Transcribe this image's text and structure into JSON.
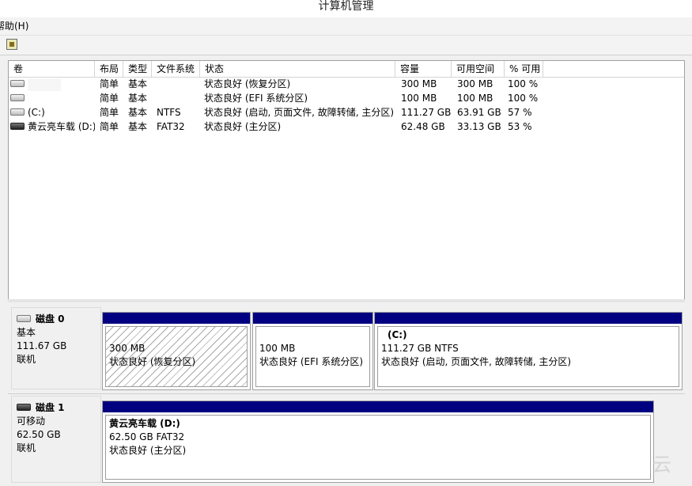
{
  "window": {
    "title": "计算机管理"
  },
  "menu": {
    "help": "帮助(H)"
  },
  "toolbar": {
    "icon": "disk-properties-icon"
  },
  "volumes": {
    "columns": [
      "卷",
      "布局",
      "类型",
      "文件系统",
      "状态",
      "容量",
      "可用空间",
      "% 可用"
    ],
    "rows": [
      {
        "icon": "drive-icon",
        "volume": "",
        "layout": "简单",
        "type": "基本",
        "fs": "",
        "status": "状态良好 (恢复分区)",
        "capacity": "300 MB",
        "free": "300 MB",
        "pct": "100 %"
      },
      {
        "icon": "drive-icon",
        "volume": "",
        "layout": "简单",
        "type": "基本",
        "fs": "",
        "status": "状态良好 (EFI 系统分区)",
        "capacity": "100 MB",
        "free": "100 MB",
        "pct": "100 %"
      },
      {
        "icon": "drive-icon",
        "volume": "(C:)",
        "layout": "简单",
        "type": "基本",
        "fs": "NTFS",
        "status": "状态良好 (启动, 页面文件, 故障转储, 主分区)",
        "capacity": "111.27 GB",
        "free": "63.91 GB",
        "pct": "57 %"
      },
      {
        "icon": "removable-drive-icon",
        "volume": "黄云亮车载 (D:)",
        "layout": "简单",
        "type": "基本",
        "fs": "FAT32",
        "status": "状态良好 (主分区)",
        "capacity": "62.48 GB",
        "free": "33.13 GB",
        "pct": "53 %"
      }
    ]
  },
  "disks": [
    {
      "name": "磁盘 0",
      "type": "基本",
      "size": "111.67 GB",
      "state": "联机",
      "partitions": [
        {
          "title": "",
          "line1": "300 MB",
          "line2": "状态良好 (恢复分区)"
        },
        {
          "title": "",
          "line1": "100 MB",
          "line2": "状态良好 (EFI 系统分区)"
        },
        {
          "title": "(C:)",
          "line1": "111.27 GB NTFS",
          "line2": "状态良好 (启动, 页面文件, 故障转储, 主分区)"
        }
      ]
    },
    {
      "name": "磁盘 1",
      "type": "可移动",
      "size": "62.50 GB",
      "state": "联机",
      "partitions": [
        {
          "title": "黄云亮车载  (D:)",
          "line1": "62.50 GB FAT32",
          "line2": "状态良好 (主分区)"
        }
      ]
    }
  ],
  "watermark": "云"
}
